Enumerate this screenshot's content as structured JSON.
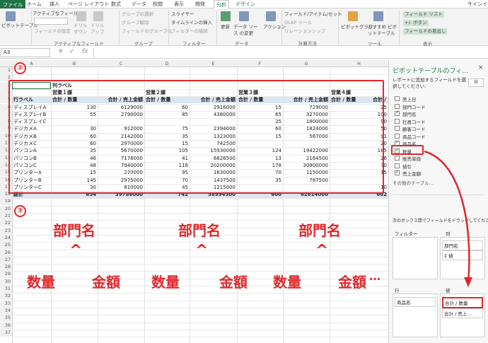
{
  "tabs": [
    "ファイル",
    "ホーム",
    "挿入",
    "ページ レイアウト",
    "数式",
    "データ",
    "校閲",
    "表示",
    "開発",
    "分析",
    "デザイン",
    "サインイン"
  ],
  "ribbon": {
    "pivot_table": "ピボットテーブル",
    "active_field_label": "アクティブなフィールド:",
    "field_settings": "フィールドの設定",
    "drill_down": "ドリル ダウン",
    "drill_up": "ドリル アップ",
    "group_selection": "グループの選択",
    "ungroup": "グループ解除",
    "group_field": "フィールドのグループ化",
    "slicer": "スライサー",
    "timeline": "タイムラインの挿入",
    "filter_connections": "フィルターの接続",
    "refresh": "更新",
    "change_source": "データ ソース の変更",
    "actions": "アクション",
    "fields_items": "フィールド/アイテム/セット",
    "olap_tools": "OLAP ツール",
    "relationships": "リレーションシップ",
    "pivot_chart": "ピボットグラフ",
    "recommended": "おすすめ ピボットテーブル",
    "field_list": "フィールド リスト",
    "buttons": "+/- ボタン",
    "field_headers": "フィールドの見出し",
    "groups": [
      "アクティブなフィールド",
      "グループ",
      "フィルター",
      "データ",
      "計算方法",
      "ツール",
      "表示"
    ]
  },
  "formula_bar": {
    "name_box": "A3",
    "fx": "fx"
  },
  "columns": [
    "A",
    "B",
    "C",
    "D",
    "E",
    "F",
    "G",
    "H"
  ],
  "rows": [
    "1",
    "2",
    "3",
    "4",
    "5",
    "6",
    "7",
    "8",
    "9",
    "10",
    "11",
    "12",
    "13",
    "14",
    "15",
    "16",
    "17",
    "18",
    "19",
    "20",
    "21",
    "22",
    "23",
    "24",
    "25",
    "26",
    "27",
    "28",
    "29",
    "30",
    "31",
    "32",
    "33",
    "34",
    "35",
    "36",
    "37"
  ],
  "pivot": {
    "col_label": "列ラベル",
    "row_label": "行ラベル",
    "groups": [
      "営業１課",
      "営業２課",
      "営業３課",
      "営業４課"
    ],
    "sub_qty": "合計 / 数量",
    "sub_amt": "合計 / 売上金額",
    "sub_more": "合計 /",
    "data": [
      [
        "ディスプレイA",
        "130",
        "6129000",
        "60",
        "2916000",
        "15",
        "729000",
        "25"
      ],
      [
        "ディスプレイB",
        "55",
        "2790000",
        "85",
        "4380000",
        "65",
        "3270000",
        "100"
      ],
      [
        "ディスプレイC",
        "",
        "",
        "",
        "",
        "25",
        "1800000",
        "90"
      ],
      [
        "デジカメA",
        "30",
        "912000",
        "75",
        "2394000",
        "60",
        "1824000",
        "50"
      ],
      [
        "デジカメB",
        "60",
        "2142000",
        "35",
        "1323000",
        "15",
        "567000",
        "91"
      ],
      [
        "デジカメC",
        "60",
        "2970000",
        "15",
        "742500",
        "",
        "",
        "20"
      ],
      [
        "パソコンA",
        "35",
        "5670000",
        "105",
        "15930000",
        "124",
        "19422000",
        "185"
      ],
      [
        "パソコンB",
        "46",
        "7178000",
        "41",
        "6826500",
        "13",
        "2164500",
        "26"
      ],
      [
        "パソコンC",
        "48",
        "7940000",
        "116",
        "20200000",
        "178",
        "30900000",
        "70"
      ],
      [
        "プリンターA",
        "15",
        "270000",
        "95",
        "1630000",
        "70",
        "1150000",
        "15"
      ],
      [
        "プリンターB",
        "145",
        "2975000",
        "70",
        "1437500",
        "35",
        "787500",
        ""
      ],
      [
        "プリンターC",
        "30",
        "810000",
        "45",
        "1215000",
        "",
        "",
        "10"
      ]
    ],
    "total": [
      "総計",
      "654",
      "39786000",
      "742",
      "58994500",
      "600",
      "62614000",
      "682"
    ]
  },
  "annotations": {
    "n1": "①",
    "n2": "②",
    "n3": "③",
    "top": "部門名",
    "qty": "数量",
    "amt": "金額",
    "caret": "^",
    "dots": "…"
  },
  "pane": {
    "title": "ピボットテーブルのフィ…",
    "close": "×",
    "instruction": "レポートに追加するフィールドを選択してください:",
    "fields": [
      {
        "label": "売上日",
        "on": false
      },
      {
        "label": "部門コード",
        "on": false
      },
      {
        "label": "部門名",
        "on": true
      },
      {
        "label": "社員コード",
        "on": false
      },
      {
        "label": "顧客コード",
        "on": false
      },
      {
        "label": "商品コード",
        "on": false
      },
      {
        "label": "商品名",
        "on": true
      },
      {
        "label": "数量",
        "on": true
      },
      {
        "label": "販売単価",
        "on": false
      },
      {
        "label": "値引",
        "on": false
      },
      {
        "label": "売上金額",
        "on": true
      }
    ],
    "more_tables": "その他のテーブル...",
    "drag_hint": "次のボックス間でフィールドをドラッグしてください:",
    "filter": "フィルター",
    "columns": "列",
    "rows": "行",
    "values": "値",
    "col_items": [
      "部門名",
      "Σ 値"
    ],
    "row_items": [
      "商品名"
    ],
    "val_items": [
      "合計 / 数量",
      "合計 / 売上…"
    ]
  },
  "colors": {
    "accent": "#217346",
    "annotation": "#e0282c"
  }
}
